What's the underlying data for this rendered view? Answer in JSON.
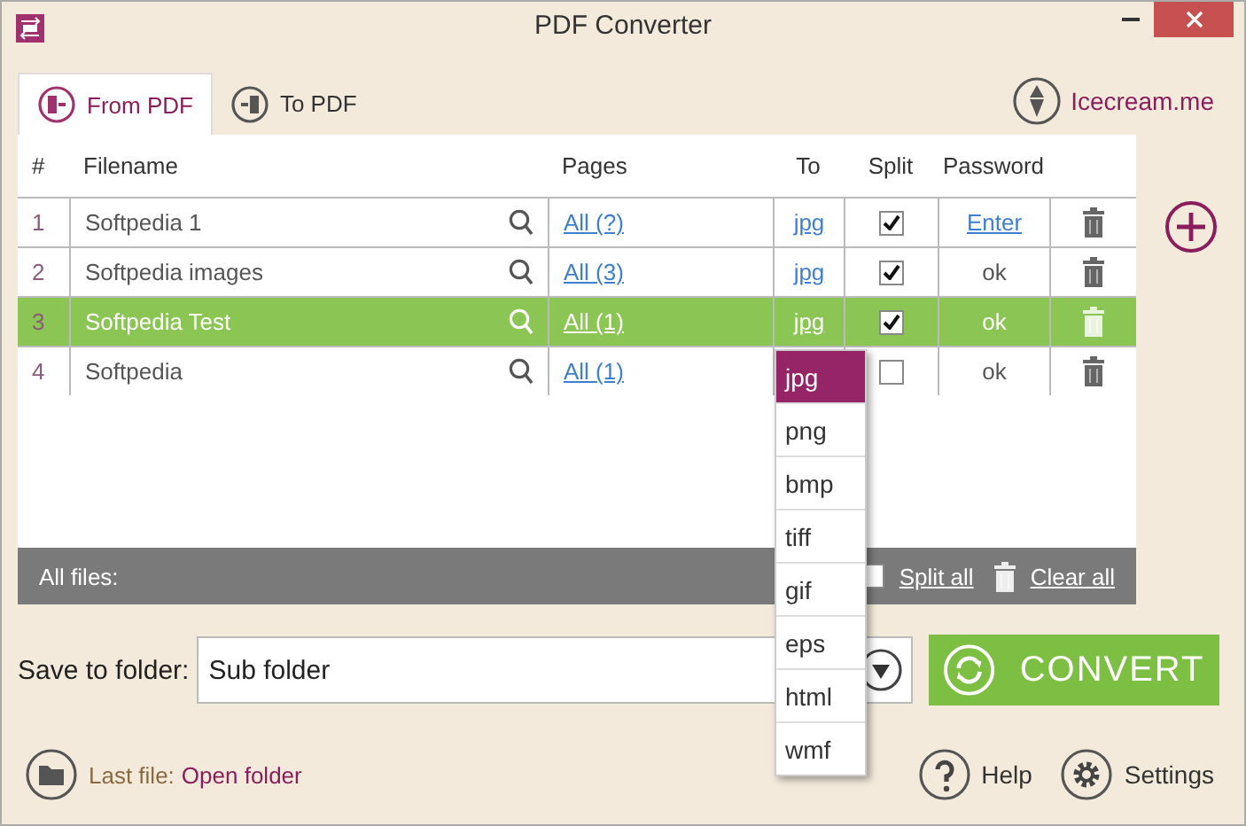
{
  "window": {
    "title": "PDF Converter"
  },
  "tabs": [
    {
      "label": "From PDF",
      "selected": true
    },
    {
      "label": "To PDF",
      "selected": false
    }
  ],
  "brand": {
    "label": "Icecream.me"
  },
  "table": {
    "columns": [
      "#",
      "Filename",
      "Pages",
      "To",
      "Split",
      "Password"
    ],
    "rows": [
      {
        "number": "1",
        "filename": "Softpedia 1",
        "pages": "All (?)",
        "format": "jpg",
        "split": true,
        "password": "Enter",
        "kind": "link",
        "selected": false
      },
      {
        "number": "2",
        "filename": "Softpedia images",
        "pages": "All (3)",
        "format": "jpg",
        "split": true,
        "password": "ok",
        "kind": "text",
        "selected": false
      },
      {
        "number": "3",
        "filename": "Softpedia Test",
        "pages": "All (1)",
        "format": "jpg",
        "split": true,
        "password": "ok",
        "kind": "text",
        "selected": true
      },
      {
        "number": "4",
        "filename": "Softpedia",
        "pages": "All (1)",
        "format": "",
        "split": false,
        "password": "ok",
        "kind": "text",
        "selected": false
      }
    ]
  },
  "format_menu": [
    {
      "label": "jpg",
      "selected": true
    },
    {
      "label": "png",
      "selected": false
    },
    {
      "label": "bmp",
      "selected": false
    },
    {
      "label": "tiff",
      "selected": false
    },
    {
      "label": "gif",
      "selected": false
    },
    {
      "label": "eps",
      "selected": false
    },
    {
      "label": "html",
      "selected": false
    },
    {
      "label": "wmf",
      "selected": false
    }
  ],
  "footer": {
    "label": "All files:",
    "split_all": {
      "label": "Split all",
      "checked": false
    },
    "clear_all": "Clear all"
  },
  "save": {
    "label": "Save to folder:",
    "value": "Sub folder"
  },
  "convert": "CONVERT",
  "last_file": {
    "label": "Last file:",
    "link": "Open folder"
  },
  "help": "Help",
  "settings": "Settings"
}
